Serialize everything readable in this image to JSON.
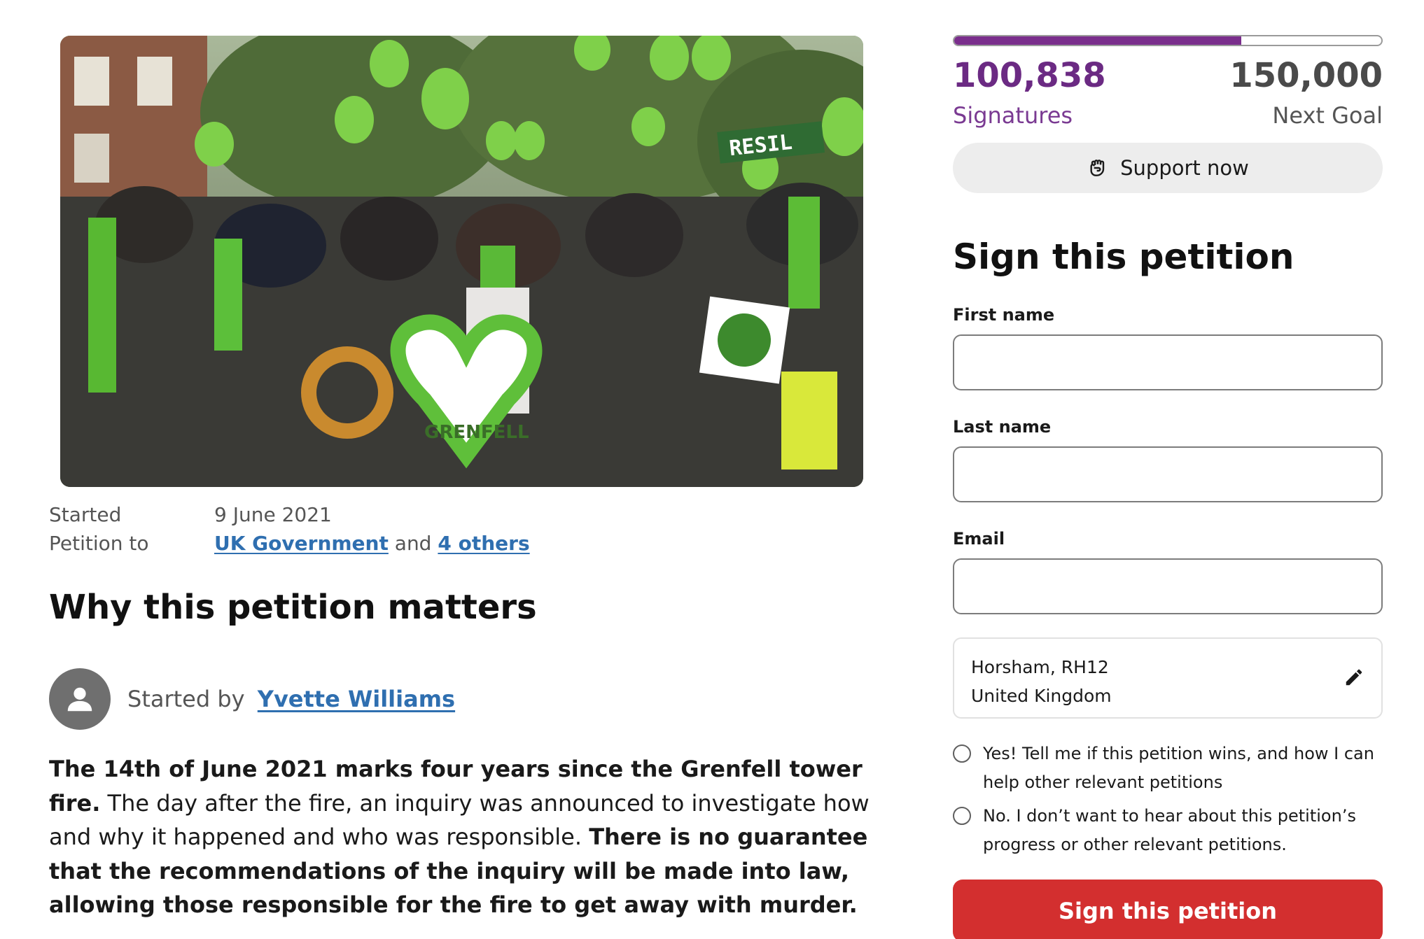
{
  "hero": {
    "image_alt": "photo-grenfell-memorial",
    "wreath_text": "GRENFELL",
    "banner_text": "RESIL"
  },
  "meta": {
    "started_label": "Started",
    "started_value": "9 June 2021",
    "petition_to_label": "Petition to",
    "target_primary": "UK Government",
    "and_text": "and",
    "target_others": "4 others"
  },
  "matters_title": "Why this petition matters",
  "starter": {
    "prefix": "Started by",
    "name": "Yvette Williams"
  },
  "body": {
    "p1_bold": "The 14th of June 2021 marks four years since the Grenfell tower fire.",
    "p1_rest": " The day after the fire, an inquiry was announced to investigate how and why it happened and who was responsible.  ",
    "p2_bold": "There is no guarantee that the recommendations of the inquiry will be made into law, allowing those responsible for the fire to get away with murder."
  },
  "progress": {
    "signatures": "100,838",
    "goal": "150,000",
    "fraction": 0.672,
    "signatures_label": "Signatures",
    "goal_label": "Next Goal",
    "color": "#7a2e8c"
  },
  "support_button": {
    "label": "Support now",
    "icon": "fist-icon"
  },
  "sign_form": {
    "title": "Sign this petition",
    "first_name_label": "First name",
    "last_name_label": "Last name",
    "email_label": "Email",
    "location_line1": "Horsham, RH12",
    "location_line2": "United Kingdom",
    "opt_in": "Yes! Tell me if this petition wins, and how I can help other relevant petitions",
    "opt_out": "No. I don’t want to hear about this petition’s progress or other relevant petitions.",
    "submit_label": "Sign this petition",
    "submit_color": "#d32f2f"
  }
}
